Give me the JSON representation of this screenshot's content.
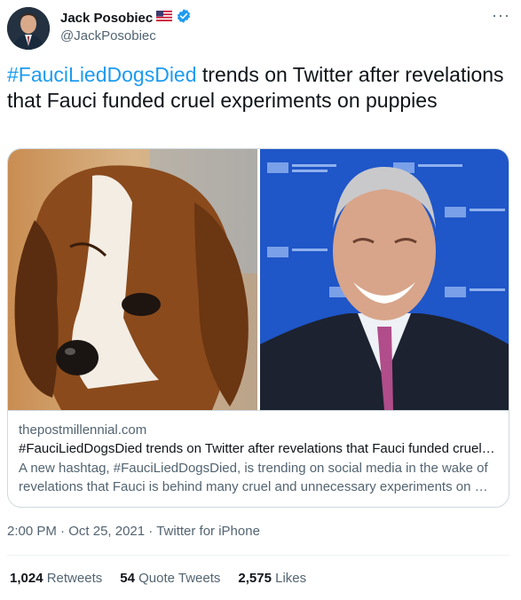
{
  "author": {
    "display_name": "Jack Posobiec",
    "handle": "@JackPosobiec",
    "flag_icon": "us-flag-icon",
    "verified_icon": "verified-badge-icon"
  },
  "more_label": "···",
  "tweet": {
    "hashtag": "#FauciLiedDogsDied",
    "text": " trends on Twitter after revelations that Fauci funded cruel experiments on puppies"
  },
  "card": {
    "domain": "thepostmillennial.com",
    "title": "#FauciLiedDogsDied trends on Twitter after revelations that Fauci funded cruel…",
    "description": "A new hashtag, #FauciLiedDogsDied, is trending on social media in the wake of revelations that Fauci is behind many cruel and unnecessary experiments on …"
  },
  "meta": {
    "time": "2:00 PM",
    "date": "Oct 25, 2021",
    "source": "Twitter for iPhone",
    "separator": " · "
  },
  "stats": {
    "retweets_count": "1,024",
    "retweets_label": "Retweets",
    "quotes_count": "54",
    "quotes_label": "Quote Tweets",
    "likes_count": "2,575",
    "likes_label": "Likes"
  },
  "colors": {
    "accent": "#1d9bf0",
    "text": "#0f1419",
    "secondary": "#536471",
    "border": "#cfd9de"
  }
}
